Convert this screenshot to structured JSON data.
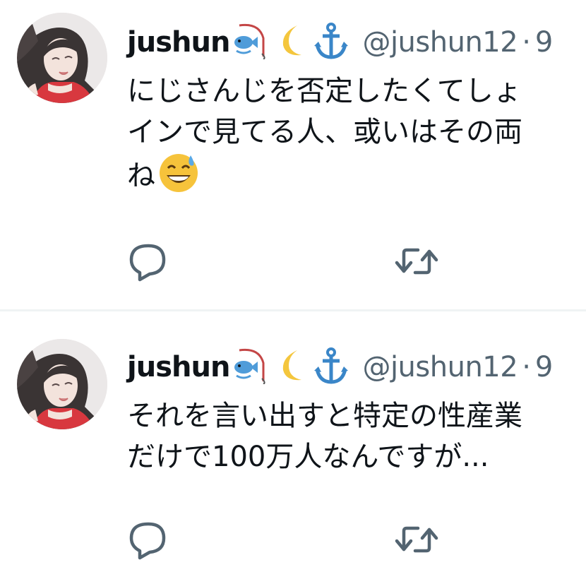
{
  "tweets": [
    {
      "display_name": "jushun",
      "name_emojis": [
        "fishing-rod-fish-emoji",
        "crescent-moon-emoji",
        "anchor-emoji"
      ],
      "handle": "@jushun12",
      "separator": "·",
      "time": "9",
      "lines": [
        "にじさんじを否定したくてしょ",
        "インで見てる人、或いはその両",
        "ね"
      ],
      "trailing_emoji": "grinning-sweat-emoji",
      "actions": [
        "reply-icon",
        "retweet-icon"
      ]
    },
    {
      "display_name": "jushun",
      "name_emojis": [
        "fishing-rod-fish-emoji",
        "crescent-moon-emoji",
        "anchor-emoji"
      ],
      "handle": "@jushun12",
      "separator": "·",
      "time": "9",
      "lines": [
        "それを言い出すと特定の性産業",
        "だけで100万人なんですが..."
      ],
      "actions": [
        "reply-icon",
        "retweet-icon"
      ]
    }
  ],
  "colors": {
    "text": "#0f1419",
    "secondary": "#536471",
    "divider": "#eff3f4",
    "anchor": "#3a86c8",
    "moon": "#f4c63d"
  }
}
